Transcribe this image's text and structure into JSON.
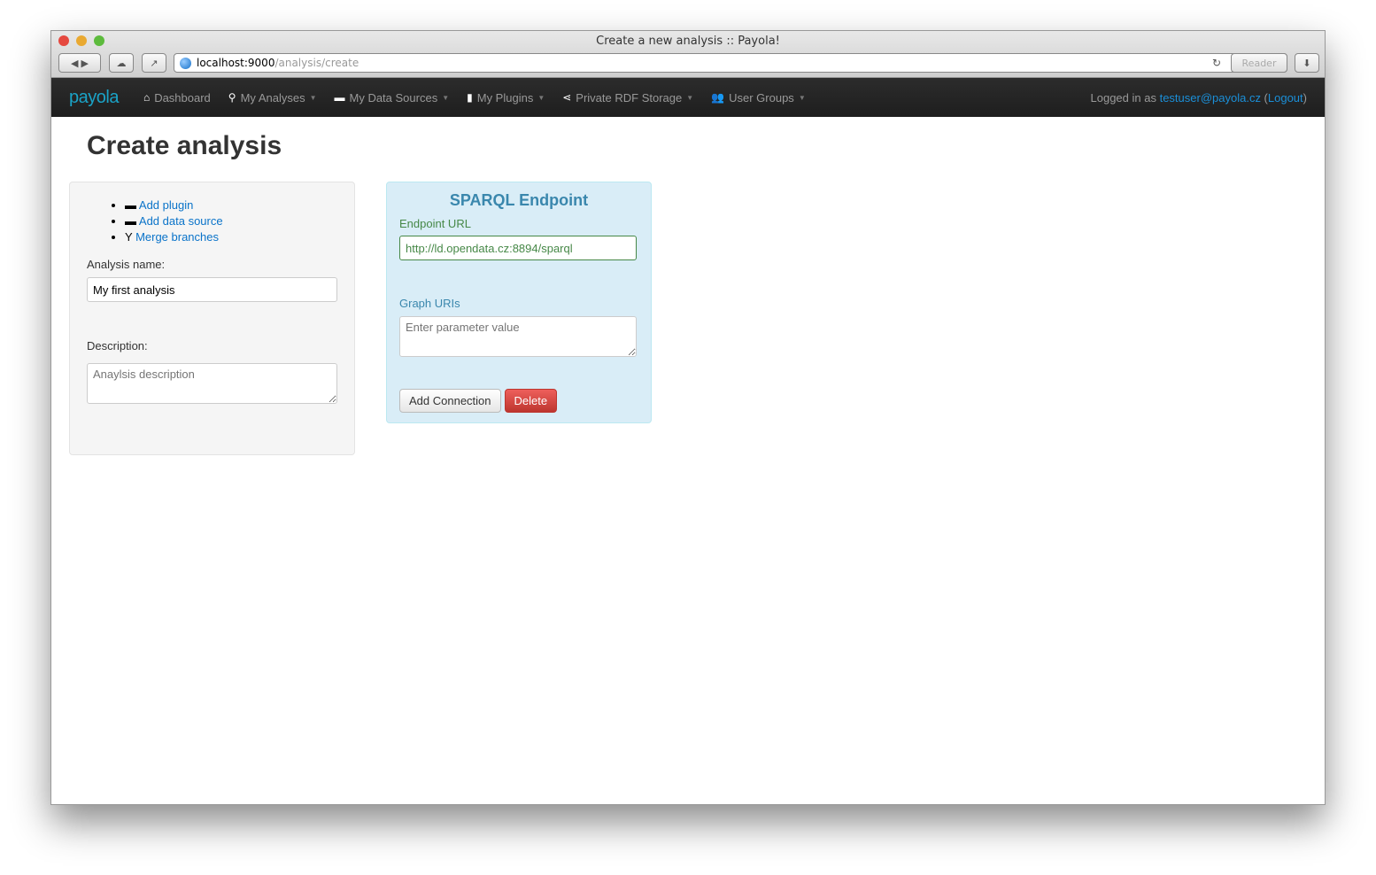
{
  "browser": {
    "title": "Create a new analysis :: Payola!",
    "url_host": "localhost:9000",
    "url_path": "/analysis/create",
    "reader": "Reader"
  },
  "nav": {
    "logo": "payola",
    "items": [
      {
        "label": "Dashboard",
        "icon": "home-icon",
        "dropdown": false
      },
      {
        "label": "My Analyses",
        "icon": "search-icon",
        "dropdown": true
      },
      {
        "label": "My Data Sources",
        "icon": "hdd-icon",
        "dropdown": true
      },
      {
        "label": "My Plugins",
        "icon": "file-icon",
        "dropdown": true
      },
      {
        "label": "Private RDF Storage",
        "icon": "share-icon",
        "dropdown": true
      },
      {
        "label": "User Groups",
        "icon": "users-icon",
        "dropdown": true
      }
    ],
    "login_prefix": "Logged in as ",
    "user": "testuser@payola.cz",
    "logout": "Logout"
  },
  "page": {
    "title": "Create analysis"
  },
  "sidebar": {
    "actions": [
      {
        "label": "Add plugin",
        "icon": "hdd-icon"
      },
      {
        "label": "Add data source",
        "icon": "hdd-icon"
      },
      {
        "label": "Merge branches",
        "icon": "filter-icon"
      }
    ],
    "name_label": "Analysis name:",
    "name_value": "My first analysis",
    "desc_label": "Description:",
    "desc_placeholder": "Anaylsis description"
  },
  "plugin": {
    "title": "SPARQL Endpoint",
    "endpoint_label": "Endpoint URL",
    "endpoint_value": "http://ld.opendata.cz:8894/sparql",
    "graph_label": "Graph URIs",
    "graph_placeholder": "Enter parameter value",
    "add_connection": "Add Connection",
    "delete": "Delete"
  },
  "colors": {
    "accent": "#1b8fd8",
    "success": "#468847",
    "info": "#3a87ad",
    "danger": "#d63b35"
  }
}
